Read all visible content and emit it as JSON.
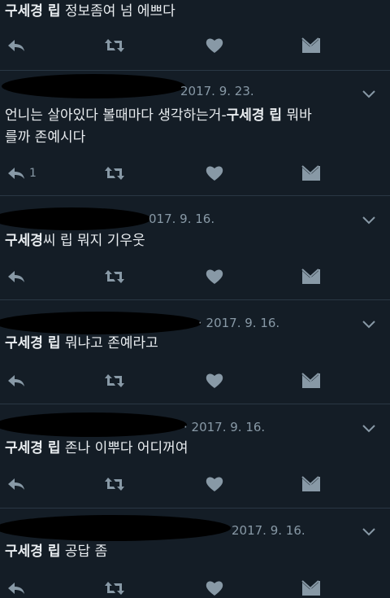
{
  "colors": {
    "background": "#141d26",
    "text": "#e8ecef",
    "muted": "#8899a6",
    "divider": "#2a3744"
  },
  "tweets": [
    {
      "date": "",
      "segments": [
        {
          "bold": "구세경 립",
          "rest": " 정보좀여 넘 에쁘다"
        }
      ],
      "reply_count": ""
    },
    {
      "date": "2017. 9. 23.",
      "line1_pre": "언니는 살아있다 볼때마다 생각하는거-",
      "line1_bold": "구세경 립",
      "line1_post": " 뭐바",
      "line2": "를까 존예시다",
      "reply_count": "1"
    },
    {
      "date": "017. 9. 16.",
      "bold": "구세경",
      "rest": "씨 립 뭐지 기우웃",
      "reply_count": ""
    },
    {
      "date": "· 2017. 9. 16.",
      "bold": "구세경 립",
      "rest": " 뭐냐고 존예라고",
      "reply_count": ""
    },
    {
      "date": "· 2017. 9. 16.",
      "bold": "구세경 립",
      "rest": " 존나 이뿌다 어디꺼여",
      "reply_count": ""
    },
    {
      "date": "2017. 9. 16.",
      "bold": "구세경 립",
      "rest": " 공답 좀",
      "reply_count": ""
    }
  ],
  "icons": {
    "reply": "reply-icon",
    "retweet": "retweet-icon",
    "like": "heart-icon",
    "dm": "envelope-icon",
    "more": "chevron-down-icon"
  }
}
